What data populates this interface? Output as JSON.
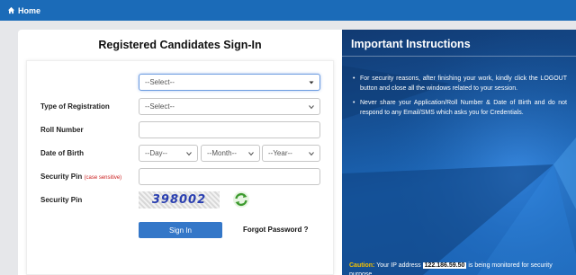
{
  "topbar": {
    "home_label": "Home"
  },
  "login": {
    "title": "Registered Candidates Sign-In",
    "first_select": {
      "value": "--Select--"
    },
    "registration_type": {
      "label": "Type of Registration",
      "value": "--Select--"
    },
    "roll_number": {
      "label": "Roll Number",
      "value": ""
    },
    "dob": {
      "label": "Date of Birth",
      "day": "--Day--",
      "month": "--Month--",
      "year": "--Year--"
    },
    "security_pin_input": {
      "label": "Security Pin",
      "hint": "(case sensitive)",
      "value": ""
    },
    "security_pin_captcha": {
      "label": "Security Pin",
      "code": "398002"
    },
    "sign_in_label": "Sign In",
    "forgot_label": "Forgot Password ?"
  },
  "instructions": {
    "title": "Important Instructions",
    "items": [
      "For security reasons, after finishing your work, kindly click the LOGOUT button and close all the windows related to your session.",
      "Never share your Application/Roll Number & Date of Birth and do not respond to any Email/SMS which asks you for Credentials."
    ],
    "caution_label": "Caution:",
    "caution_pre": "Your IP address",
    "ip_address": "122.186.59.50",
    "caution_post": "is being monitored for security purpose."
  },
  "colors": {
    "topbar": "#1b6bb8",
    "panel": "#165196",
    "button": "#3477c8",
    "caution": "#f5c000"
  },
  "icons": [
    "home-icon",
    "chevron-down-icon",
    "refresh-icon"
  ]
}
